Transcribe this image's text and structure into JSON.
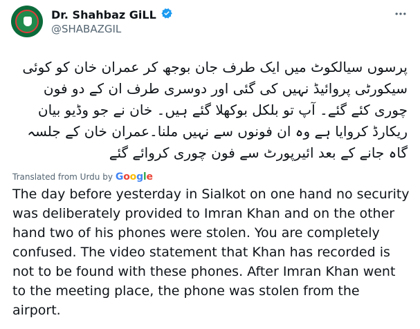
{
  "author": {
    "name": "Dr. Shahbaz GiLL",
    "handle": "@SHABAZGIL"
  },
  "tweet": {
    "urdu_text": "پرسوں سیالکوٹ میں ایک طرف جان بوجھ کر عمران خان کو کوئی سیکورٹی پروائیڈ نہیں کی گئی اور دوسری طرف ان کے دو فون چوری کئے گئے۔ آپ تو بلکل بوکھلا گئے ہیں۔ خان نے جو وڈیو بیان ریکارڈ کروایا ہے وہ ان فونوں سے نہیں ملنا۔عمران خان کے جلسہ گاہ جانے کے بعد ائیرپورٹ سے فون چوری کروائے گئے",
    "translated_label": "Translated from Urdu by",
    "google_label": "Google",
    "english_text": "The day before yesterday in Sialkot on one hand no security was deliberately provided to Imran Khan and on the other hand two of his phones were stolen. You are completely confused. The video statement that Khan has recorded is not to be found with these phones. After Imran Khan went to the meeting place, the phone was stolen from the airport."
  },
  "colors": {
    "verified": "#1d9bf0",
    "muted": "#536471"
  }
}
